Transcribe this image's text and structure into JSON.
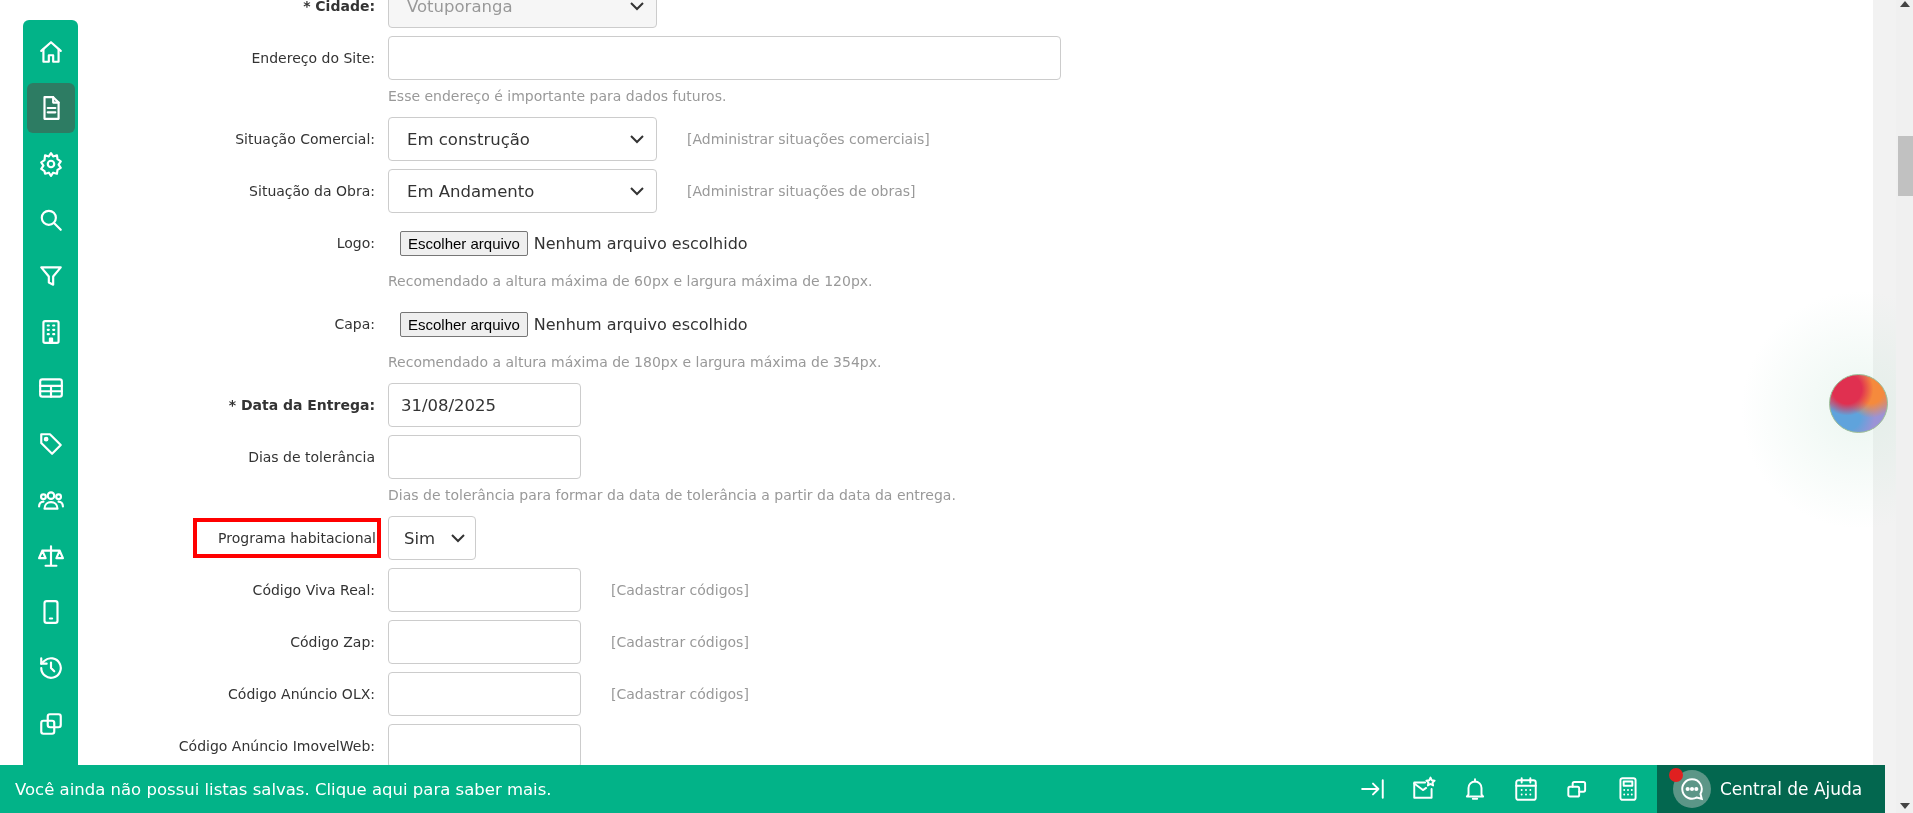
{
  "sidebar": {
    "items": [
      {
        "kind": "home",
        "selected": false
      },
      {
        "kind": "document",
        "selected": true
      },
      {
        "kind": "gear",
        "selected": false
      },
      {
        "kind": "search",
        "selected": false
      },
      {
        "kind": "filter",
        "selected": false
      },
      {
        "kind": "building",
        "selected": false
      },
      {
        "kind": "table",
        "selected": false
      },
      {
        "kind": "tag",
        "selected": false
      },
      {
        "kind": "people",
        "selected": false
      },
      {
        "kind": "scale",
        "selected": false
      },
      {
        "kind": "phone",
        "selected": false
      },
      {
        "kind": "history",
        "selected": false
      },
      {
        "kind": "copy",
        "selected": false
      }
    ]
  },
  "form": {
    "rows": [
      {
        "kind": "select",
        "label": "* Cidade:",
        "required": true,
        "value": "Votuporanga",
        "disabled": true,
        "highlighted": false
      },
      {
        "kind": "url",
        "label": "Endereço do Site:",
        "required": false,
        "hint": "Esse endereço é importante para dados futuros.",
        "highlighted": false
      },
      {
        "kind": "select",
        "label": "Situação Comercial:",
        "required": false,
        "value": "Em construção",
        "disabled": false,
        "link": "[Administrar situações comerciais]",
        "highlighted": false
      },
      {
        "kind": "select",
        "label": "Situação da Obra:",
        "required": false,
        "value": "Em Andamento",
        "disabled": false,
        "link": "[Administrar situações de obras]",
        "highlighted": false
      },
      {
        "kind": "file",
        "label": "Logo:",
        "required": false,
        "button": "Escolher arquivo",
        "status": "Nenhum arquivo escolhido",
        "hint": "Recomendado a altura máxima de 60px e largura máxima de 120px.",
        "highlighted": false
      },
      {
        "kind": "file",
        "label": "Capa:",
        "required": false,
        "button": "Escolher arquivo",
        "status": "Nenhum arquivo escolhido",
        "hint": "Recomendado a altura máxima de 180px e largura máxima de 354px.",
        "highlighted": false
      },
      {
        "kind": "text",
        "label": "* Data da Entrega:",
        "required": true,
        "value": "31/08/2025",
        "highlighted": false
      },
      {
        "kind": "text",
        "label": "Dias de tolerância",
        "required": false,
        "hint": "Dias de tolerância para formar da data de tolerância a partir da data da entrega.",
        "highlighted": false
      },
      {
        "kind": "small-select",
        "label": "Programa habitacional",
        "required": false,
        "value": "Sim",
        "disabled": false,
        "highlighted": true
      },
      {
        "kind": "text",
        "label": "Código Viva Real:",
        "required": false,
        "link": "[Cadastrar códigos]",
        "highlighted": false
      },
      {
        "kind": "text",
        "label": "Código Zap:",
        "required": false,
        "link": "[Cadastrar códigos]",
        "highlighted": false
      },
      {
        "kind": "text",
        "label": "Código Anúncio OLX:",
        "required": false,
        "link": "[Cadastrar códigos]",
        "highlighted": false
      },
      {
        "kind": "text",
        "label": "Código Anúncio ImovelWeb:",
        "required": false,
        "highlighted": false
      }
    ]
  },
  "footer": {
    "message": "Você ainda não possui listas salvas. Clique aqui para saber mais.",
    "tools": [
      {
        "kind": "collapse"
      },
      {
        "kind": "mail"
      },
      {
        "kind": "bell"
      },
      {
        "kind": "calendar"
      },
      {
        "kind": "windows"
      },
      {
        "kind": "calculator"
      }
    ],
    "help": {
      "label": "Central de Ajuda",
      "notification": true
    }
  }
}
